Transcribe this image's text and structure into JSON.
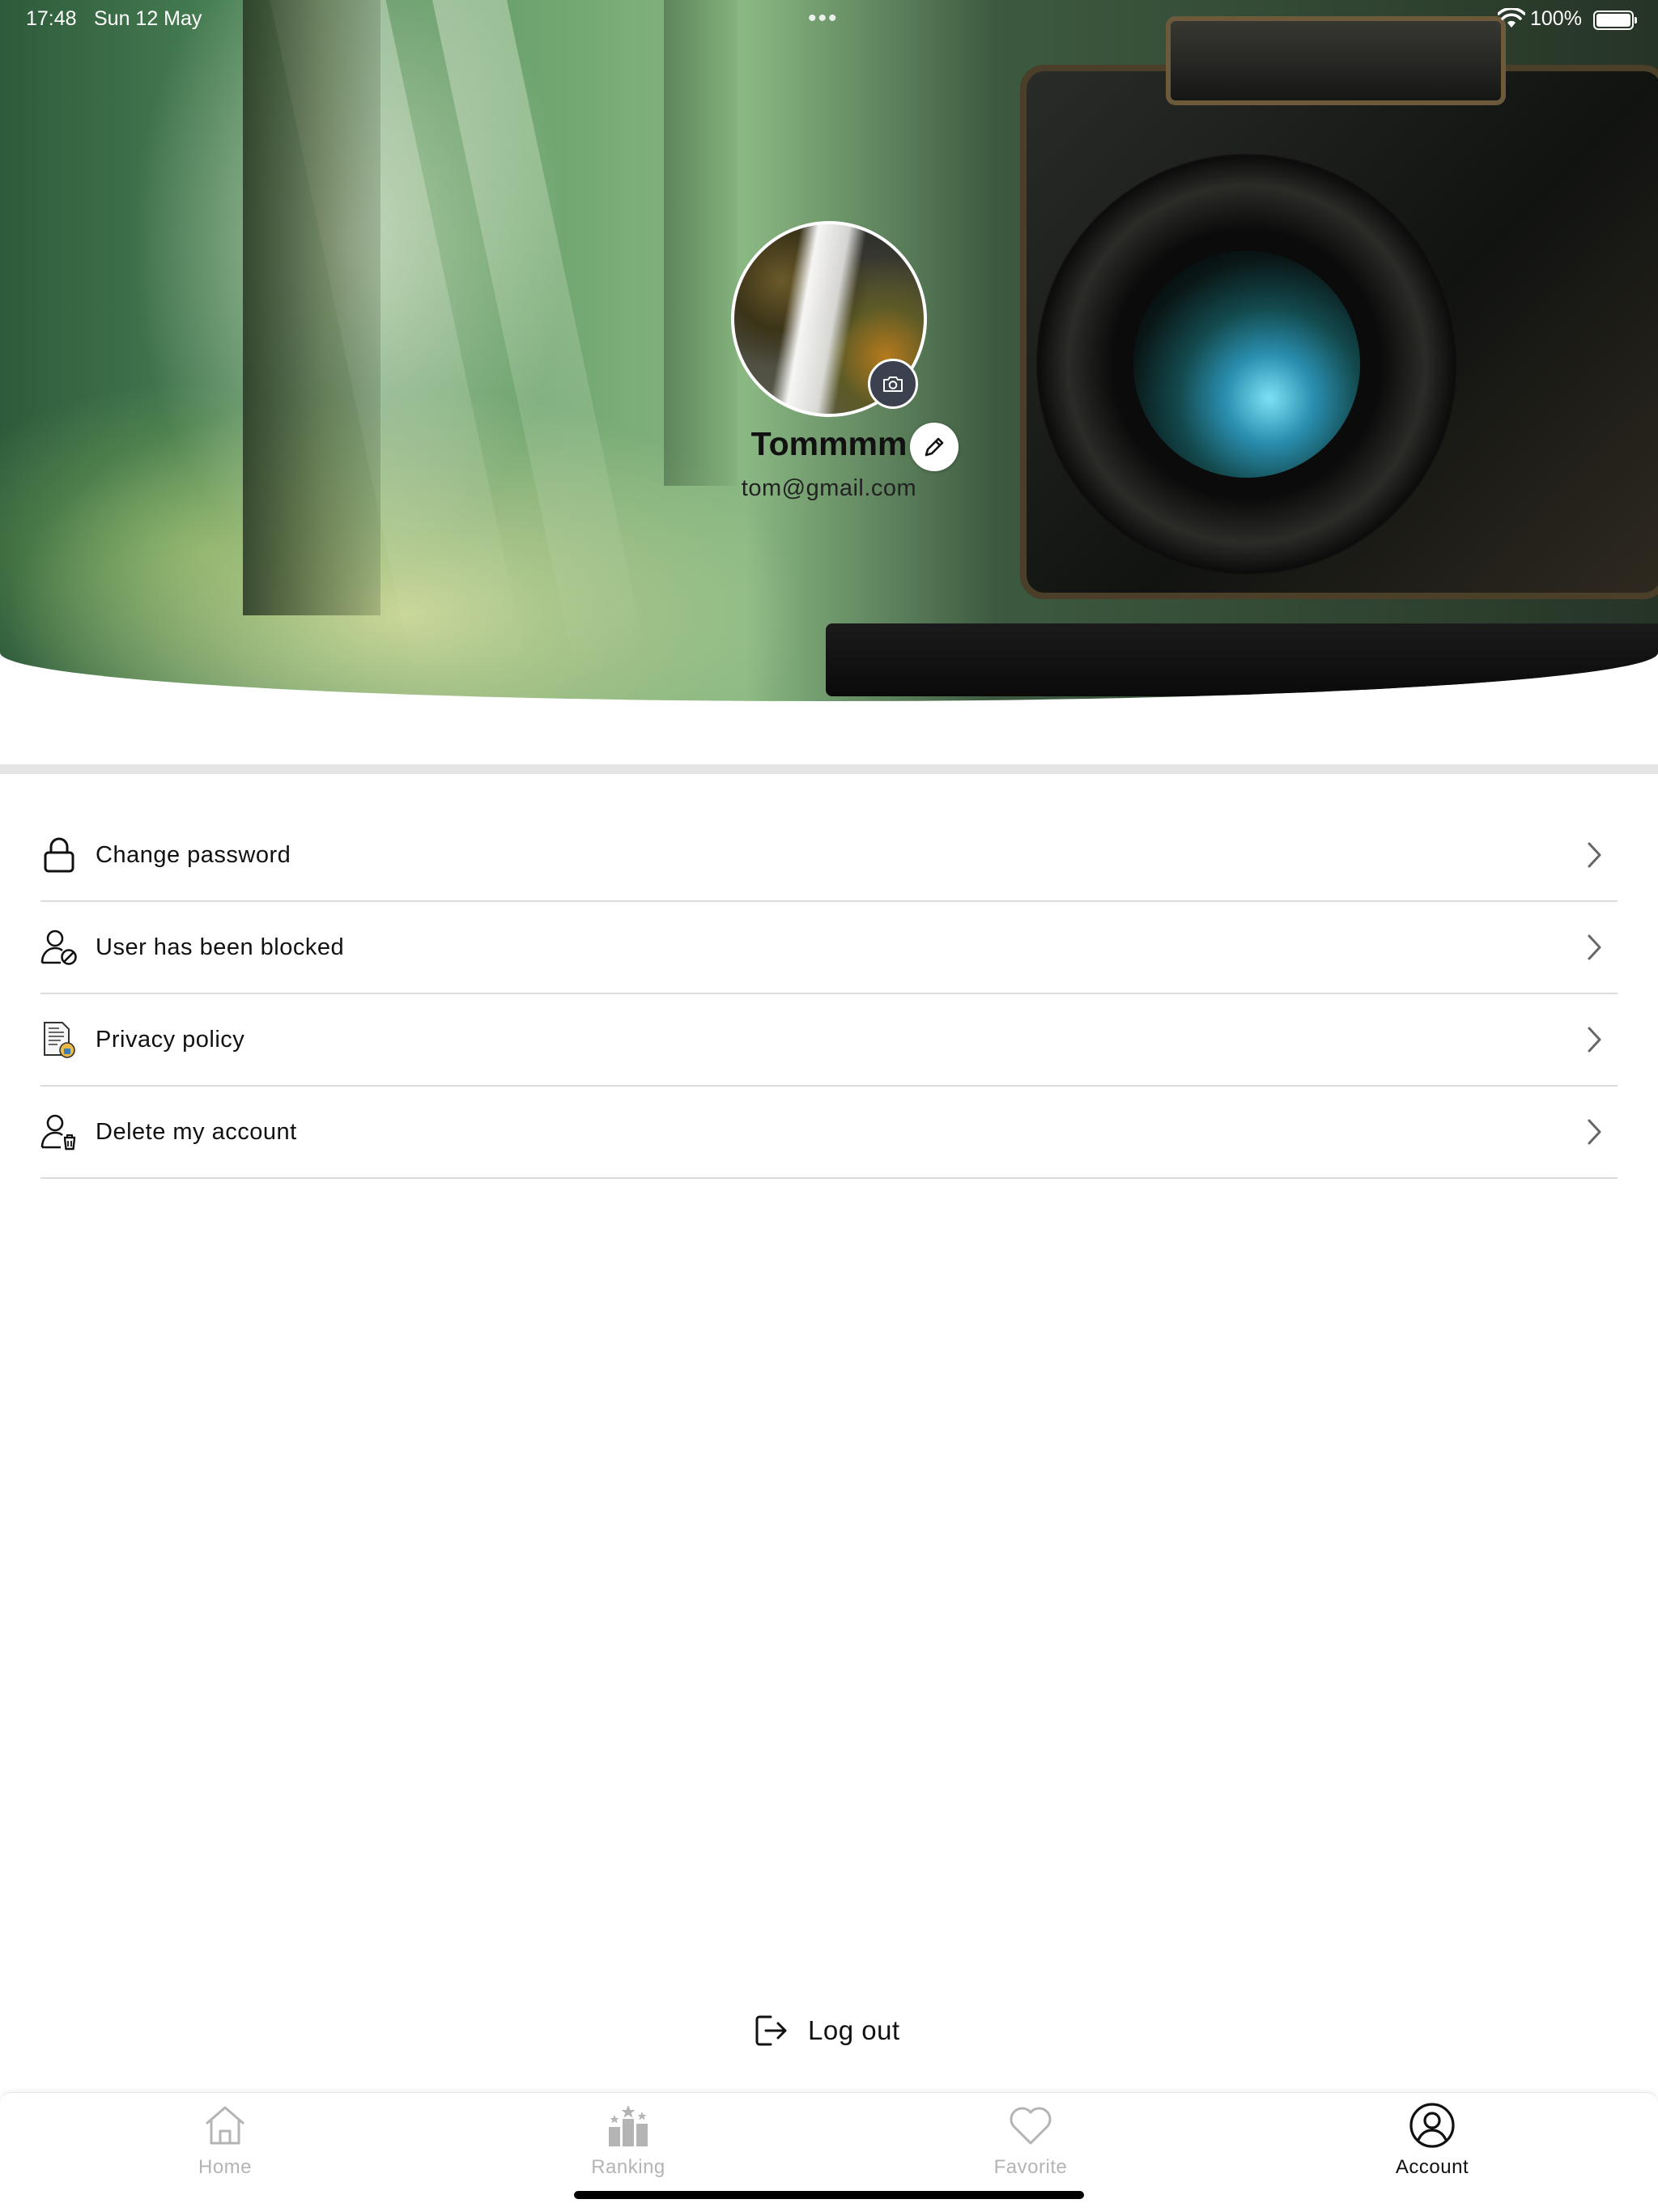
{
  "status_bar": {
    "time": "17:48",
    "date": "Sun 12 May",
    "multitask_dots": "•••",
    "battery_percent": "100%",
    "wifi_icon": "wifi-icon",
    "battery_icon": "battery-full-icon"
  },
  "profile": {
    "name": "Tommmm",
    "email": "tom@gmail.com",
    "avatar_camera_icon": "camera-icon",
    "edit_icon": "pencil-icon"
  },
  "menu": {
    "items": [
      {
        "label": "Change password",
        "icon": "lock-icon"
      },
      {
        "label": "User has been blocked",
        "icon": "user-blocked-icon"
      },
      {
        "label": "Privacy policy",
        "icon": "policy-document-icon"
      },
      {
        "label": "Delete my account",
        "icon": "user-delete-icon"
      }
    ],
    "chevron_icon": "chevron-right-icon"
  },
  "logout": {
    "label": "Log out",
    "icon": "logout-icon"
  },
  "tabbar": {
    "tabs": [
      {
        "label": "Home",
        "icon": "home-icon",
        "active": false
      },
      {
        "label": "Ranking",
        "icon": "ranking-icon",
        "active": false
      },
      {
        "label": "Favorite",
        "icon": "heart-icon",
        "active": false
      },
      {
        "label": "Account",
        "icon": "account-icon",
        "active": true
      }
    ]
  },
  "colors": {
    "active_tab": "#111111",
    "inactive_tab": "#b4b4b4",
    "divider": "#dcdcdc",
    "avatar_camera_bg": "#3c4150"
  }
}
